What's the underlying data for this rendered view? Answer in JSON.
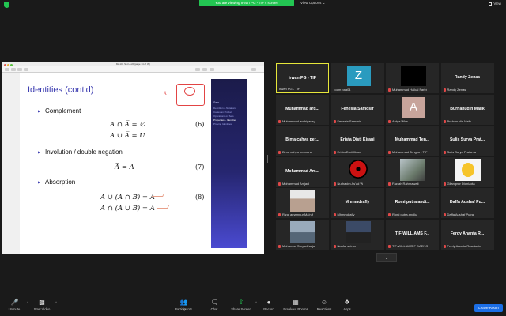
{
  "topbar": {
    "share_banner": "You are viewing Irwan PG - TIF's screen",
    "view_options": "View Options ⌄",
    "view_button": "View"
  },
  "pdf": {
    "window_title": "MA101 Set Lec6 (page 14 of 39)"
  },
  "slide": {
    "title": "Identities (cont'd)",
    "complement_label": "Complement",
    "complement_eq1": "A ∩ A̅ = ∅",
    "complement_eq2": "A ∪ A̅ = U",
    "complement_num": "(6)",
    "involution_label": "Involution / double negation",
    "involution_eq": "A̅̅ = A",
    "involution_num": "(7)",
    "absorption_label": "Absorption",
    "absorption_eq1": "A ∪ (A ∩ B) = A",
    "absorption_eq2": "A ∩ (A ∪ B) = A",
    "absorption_num": "(8)",
    "annotation_text": "A̅",
    "nav": [
      {
        "text": "Sets",
        "kind": "hd"
      },
      {
        "text": "Definition & Notations",
        "kind": ""
      },
      {
        "text": "Cartesian Product",
        "kind": ""
      },
      {
        "text": "Operations on Sets",
        "kind": ""
      },
      {
        "text": "Properties – Identities",
        "kind": "cur"
      },
      {
        "text": "Proving Identities",
        "kind": ""
      }
    ]
  },
  "participants": [
    {
      "name": "Irwan PG - TIF",
      "label": "Irwan PG - TIF",
      "style": "active",
      "muted": false
    },
    {
      "name": "",
      "label": "zoom baa04",
      "style": "z",
      "muted": false
    },
    {
      "name": "",
      "label": "Muhammad Haikal Faribi",
      "style": "black",
      "muted": true
    },
    {
      "name": "Randy Zenas",
      "label": "Randy Zenas",
      "style": "plain",
      "muted": true
    },
    {
      "name": "Muhammad  ard...",
      "label": "Muhammad ardhiyansy...",
      "style": "plain",
      "muted": true
    },
    {
      "name": "Fenesia Samosir",
      "label": "Fenesia Samosir",
      "style": "plain",
      "muted": true
    },
    {
      "name": "",
      "label": "Ardya Wira",
      "style": "a",
      "muted": true
    },
    {
      "name": "Burhanudin Malik",
      "label": "Burhanudin Malik",
      "style": "plain",
      "muted": true
    },
    {
      "name": "Bima cahya per...",
      "label": "Bima cahya permana",
      "style": "plain",
      "muted": true
    },
    {
      "name": "Erista Disti Kirani",
      "label": "Erista Disti Kirani",
      "style": "plain",
      "muted": true
    },
    {
      "name": "Muhammad  Ten...",
      "label": "Muhammad Tengku - TIF",
      "style": "plain",
      "muted": true
    },
    {
      "name": "Sulis Surya Prat...",
      "label": "Sulis Surya Pratama",
      "style": "plain",
      "muted": true
    },
    {
      "name": "Mohammad  Am...",
      "label": "Mohammad Amjadi",
      "style": "plain",
      "muted": true
    },
    {
      "name": "",
      "label": "Nurhakim As'ad W",
      "style": "sharingan",
      "muted": true
    },
    {
      "name": "",
      "label": "Fazrah Rahmawati",
      "style": "room",
      "muted": true
    },
    {
      "name": "",
      "label": "Gilangnur Dionizota",
      "style": "emoji",
      "muted": true
    },
    {
      "name": "",
      "label": "Rizqi amamnur Ma'ruf",
      "style": "person",
      "muted": true
    },
    {
      "name": "Mhmmdrafly",
      "label": "Mhmmdrafly",
      "style": "plain",
      "muted": true
    },
    {
      "name": "Romi putra andi...",
      "label": "Romi putra andika",
      "style": "plain",
      "muted": true
    },
    {
      "name": "Daffa Aushaf Pu...",
      "label": "Daffa Aushaf Putra",
      "style": "plain",
      "muted": true
    },
    {
      "name": "",
      "label": "Mohamad Suryadiharja",
      "style": "car",
      "muted": true
    },
    {
      "name": "",
      "label": "Naufal sptroo",
      "style": "dark",
      "muted": true
    },
    {
      "name": "TIF-WILLIAMS F...",
      "label": "TIF-WILLIAMS F DAENG",
      "style": "plain",
      "muted": true
    },
    {
      "name": "Ferdy Ananta R...",
      "label": "Ferdy Ananta Rusdianto",
      "style": "plain",
      "muted": true
    }
  ],
  "participant_count": "33",
  "toolbar": {
    "unmute": "Unmute",
    "start_video": "Start Video",
    "participants": "Participants",
    "chat": "Chat",
    "share_screen": "Share Screen",
    "record": "Record",
    "breakout": "Breakout Rooms",
    "reactions": "Reactions",
    "apps": "Apps",
    "leave": "Leave Room"
  },
  "colors": {
    "active_speaker": "#e6e63a",
    "share_green": "#23c552",
    "leave_blue": "#1b6ee6",
    "slide_title": "#3b3bb0"
  }
}
